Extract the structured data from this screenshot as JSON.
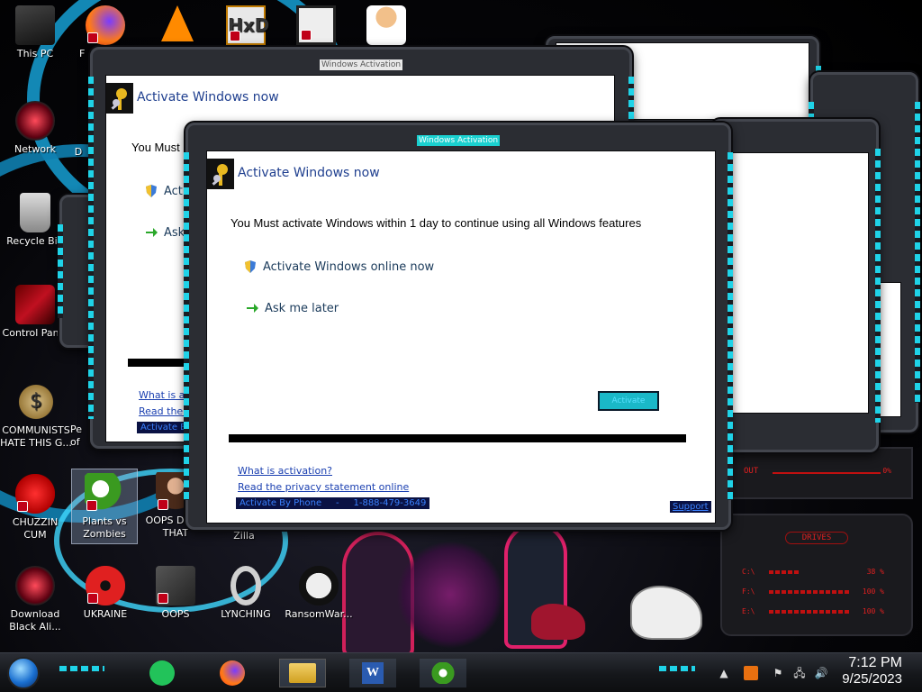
{
  "desktop_icons": [
    {
      "name": "this-pc-icon",
      "label": "This PC"
    },
    {
      "name": "firefox-desktop-icon",
      "label": "F"
    },
    {
      "name": "network-icon",
      "label": "Network"
    },
    {
      "name": "d-icon",
      "label": "D"
    },
    {
      "name": "recycle-bin-icon",
      "label": "Recycle Bin"
    },
    {
      "name": "control-panel-icon",
      "label": "Control Panel"
    },
    {
      "name": "communists-icon",
      "label": "COMMUNISTS HATE THIS G..."
    },
    {
      "name": "pe-icon",
      "label": "Pe of"
    },
    {
      "name": "chuzzin-icon",
      "label": "CHUZZIN CUM"
    },
    {
      "name": "plants-vs-zombies-icon",
      "label": "Plants vs Zombies"
    },
    {
      "name": "oops-di-icon",
      "label": "OOPS DI DO THAT"
    },
    {
      "name": "zilla-icon",
      "label": "Zilla"
    },
    {
      "name": "download-black-ali-icon",
      "label": "Download Black Ali..."
    },
    {
      "name": "ukraine-icon",
      "label": "UKRAINE"
    },
    {
      "name": "oops-icon",
      "label": "OOPS"
    },
    {
      "name": "lynching-icon",
      "label": "LYNCHING"
    },
    {
      "name": "ransomware-icon",
      "label": "RansomWar..."
    }
  ],
  "back_window": {
    "title": "Windows Activation",
    "heading": "Activate Windows now",
    "message": "You Must",
    "option_activate": "Activ",
    "option_ask": "Ask",
    "link_what": "What is acti",
    "link_privacy": "Read the p",
    "phone": "Activate By P"
  },
  "front_window": {
    "title": "Windows Activation",
    "heading": "Activate Windows now",
    "message": "You Must activate Windows within 1 day to continue using all Windows features",
    "option_activate": "Activate Windows online now",
    "option_ask": "Ask me later",
    "activate_button": "Activate",
    "link_what": "What is activation?",
    "link_privacy": "Read the privacy statement online",
    "phone": "Activate By Phone     -     1-888-479-3649",
    "support": "Support"
  },
  "alien_panel": {
    "out_label": "OUT",
    "out_value": "0%",
    "drives_label": "DRIVES",
    "drives": [
      {
        "label": "C:\\",
        "value": "38 %"
      },
      {
        "label": "F:\\",
        "value": "100 %"
      },
      {
        "label": "E:\\",
        "value": "100 %"
      }
    ]
  },
  "taskbar": {
    "time": "7:12 PM",
    "date": "9/25/2023"
  }
}
